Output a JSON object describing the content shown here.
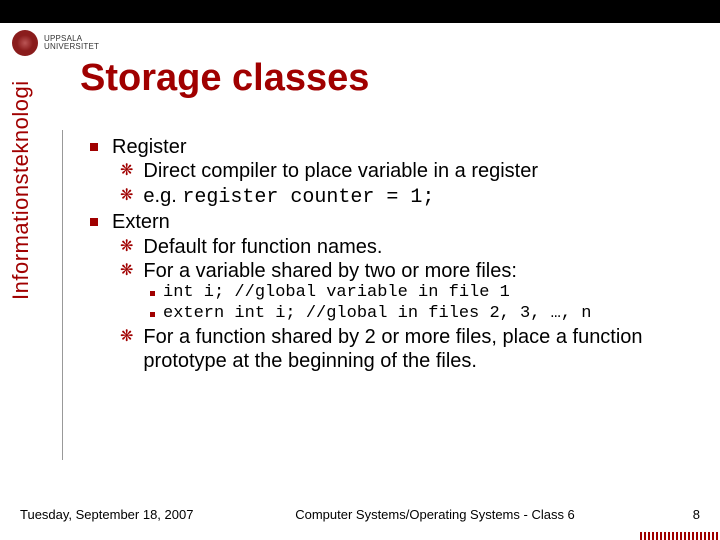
{
  "university": {
    "name_line1": "UPPSALA",
    "name_line2": "UNIVERSITET"
  },
  "sidebar_label": "Informationsteknologi",
  "title": "Storage classes",
  "bullets": {
    "b1": {
      "label": "Register",
      "s1": "Direct compiler to place variable in a register",
      "s2_prefix": "e.g. ",
      "s2_code": "register counter = 1;"
    },
    "b2": {
      "label": "Extern",
      "s1": "Default for function names.",
      "s2": "For a variable shared by two or more files:",
      "c1": "int i; //global variable in file 1",
      "c2": "extern int i; //global in files 2, 3, …, n",
      "s3": "For a function shared by 2 or more files, place a function prototype at the beginning of the files."
    }
  },
  "footer": {
    "date": "Tuesday, September 18, 2007",
    "center": "Computer Systems/Operating Systems - Class 6",
    "page": "8"
  }
}
